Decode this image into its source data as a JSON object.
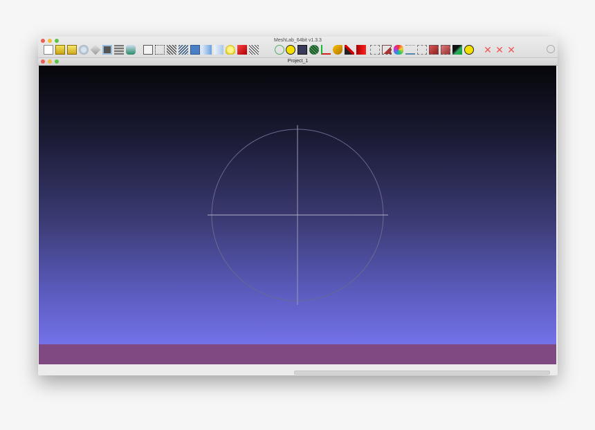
{
  "app": {
    "title": "MeshLab_64bit v1.3.3"
  },
  "document": {
    "title": "Project_1"
  },
  "colors": {
    "viewport_top": "#06060a",
    "viewport_bottom": "#7472e8",
    "band": "#7f4a82",
    "trackball": "#6a6a90"
  },
  "toolbar_icons": [
    "new-project-icon",
    "open-project-icon",
    "open-mesh-icon",
    "reload-icon",
    "save-icon",
    "snapshot-icon",
    "layers-icon",
    "color-icon",
    "bbox-icon",
    "points-icon",
    "wireframe-icon",
    "hidden-lines-icon",
    "flat-icon",
    "smooth-icon",
    "texture-icon",
    "light-icon",
    "fancy-light-icon",
    "culling-icon",
    "trackball-icon",
    "annotation-icon",
    "mesh-dark-icon",
    "green-mesh-icon",
    "axis-icon",
    "paint-icon",
    "brush-icon",
    "pickpoints-icon",
    "align-icon",
    "select-vertex-icon",
    "manipulator-icon",
    "measure-icon",
    "select-faces-icon",
    "select-connected-icon",
    "select-area-icon",
    "raster-icon",
    "info-icon",
    "delete-vertex-icon",
    "delete-face-icon",
    "delete-both-icon",
    "search-icon"
  ]
}
